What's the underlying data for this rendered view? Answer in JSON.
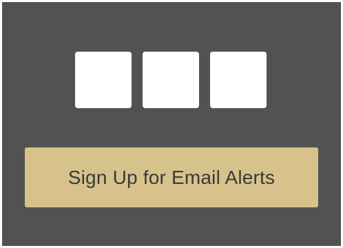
{
  "colors": {
    "panel_background": "#525252",
    "tile_background": "#ffffff",
    "button_background": "#d8c28c",
    "button_text": "#3a3a3a"
  },
  "social_tiles": [
    {
      "icon": "social-icon-1"
    },
    {
      "icon": "social-icon-2"
    },
    {
      "icon": "social-icon-3"
    }
  ],
  "cta": {
    "label": "Sign Up for Email Alerts"
  }
}
